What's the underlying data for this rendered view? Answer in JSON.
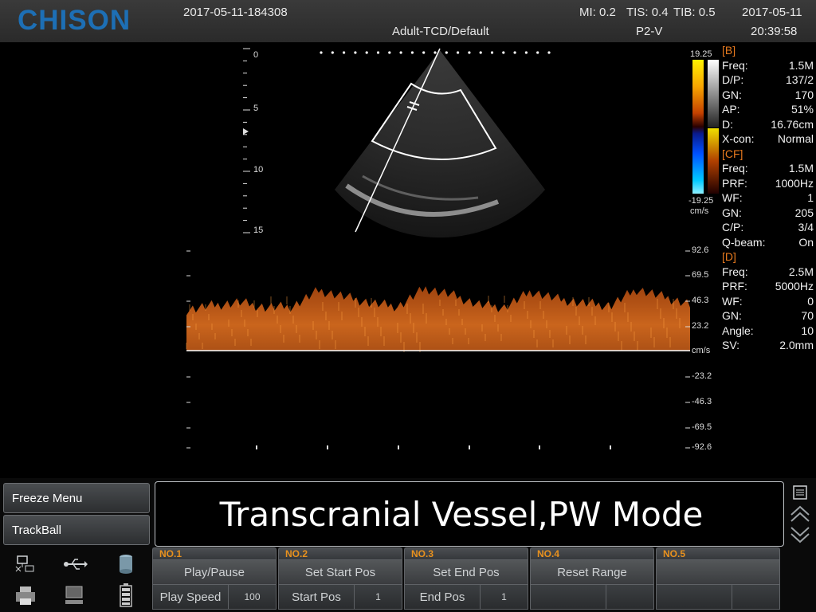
{
  "header": {
    "logo": "CHISON",
    "exam_id": "2017-05-11-184308",
    "preset": "Adult-TCD/Default",
    "mi_label": "MI:",
    "mi_value": "0.2",
    "tis_label": "TIS:",
    "tis_value": "0.4",
    "tib_label": "TIB:",
    "tib_value": "0.5",
    "probe": "P2-V",
    "date": "2017-05-11",
    "time": "20:39:58"
  },
  "bmode": {
    "depth_ticks": [
      "0",
      "5",
      "10",
      "15"
    ]
  },
  "colorbar": {
    "top": "19.25",
    "bottom": "-19.25",
    "unit": "cm/s"
  },
  "params": {
    "b": {
      "title": "[B]",
      "rows": [
        {
          "label": "Freq:",
          "value": "1.5M"
        },
        {
          "label": "D/P:",
          "value": "137/2"
        },
        {
          "label": "GN:",
          "value": "170"
        },
        {
          "label": "AP:",
          "value": "51%"
        },
        {
          "label": "D:",
          "value": "16.76cm"
        },
        {
          "label": "X-con:",
          "value": "Normal"
        }
      ]
    },
    "cf": {
      "title": "[CF]",
      "rows": [
        {
          "label": "Freq:",
          "value": "1.5M"
        },
        {
          "label": "PRF:",
          "value": "1000Hz"
        },
        {
          "label": "WF:",
          "value": "1"
        },
        {
          "label": "GN:",
          "value": "205"
        },
        {
          "label": "C/P:",
          "value": "3/4"
        },
        {
          "label": "Q-beam:",
          "value": "On"
        }
      ]
    },
    "d": {
      "title": "[D]",
      "rows": [
        {
          "label": "Freq:",
          "value": "2.5M"
        },
        {
          "label": "PRF:",
          "value": "5000Hz"
        },
        {
          "label": "WF:",
          "value": "0"
        },
        {
          "label": "GN:",
          "value": "70"
        },
        {
          "label": "Angle:",
          "value": "10"
        },
        {
          "label": "SV:",
          "value": "2.0mm"
        }
      ]
    }
  },
  "doppler": {
    "scale_labels": [
      "92.6",
      "69.5",
      "46.3",
      "23.2",
      "cm/s",
      "-23.2",
      "-46.3",
      "-69.5",
      "-92.6"
    ],
    "spectrum_peaks_cm_s": [
      38,
      42,
      45,
      40,
      41,
      56,
      50,
      44,
      41,
      58,
      52,
      43,
      40,
      55,
      48,
      44,
      42,
      57,
      50,
      43
    ]
  },
  "menu": {
    "freeze_menu": "Freeze Menu",
    "trackball": "TrackBall"
  },
  "banner": {
    "text": "Transcranial Vessel,PW Mode"
  },
  "knobs": [
    {
      "no": "NO.1",
      "action": "Play/Pause",
      "label": "Play Speed",
      "value": "100"
    },
    {
      "no": "NO.2",
      "action": "Set Start Pos",
      "label": "Start Pos",
      "value": "1"
    },
    {
      "no": "NO.3",
      "action": "Set End Pos",
      "label": "End Pos",
      "value": "1"
    },
    {
      "no": "NO.4",
      "action": "Reset Range",
      "label": "",
      "value": ""
    },
    {
      "no": "NO.5",
      "action": "",
      "label": "",
      "value": ""
    }
  ],
  "status_icons": [
    "network-icon",
    "usb-icon",
    "storage-icon",
    "printer-icon",
    "computer-icon",
    "battery-icon"
  ],
  "colors": {
    "accent": "#e8911e",
    "logo": "#1d6fb5",
    "section": "#e87a1e"
  }
}
